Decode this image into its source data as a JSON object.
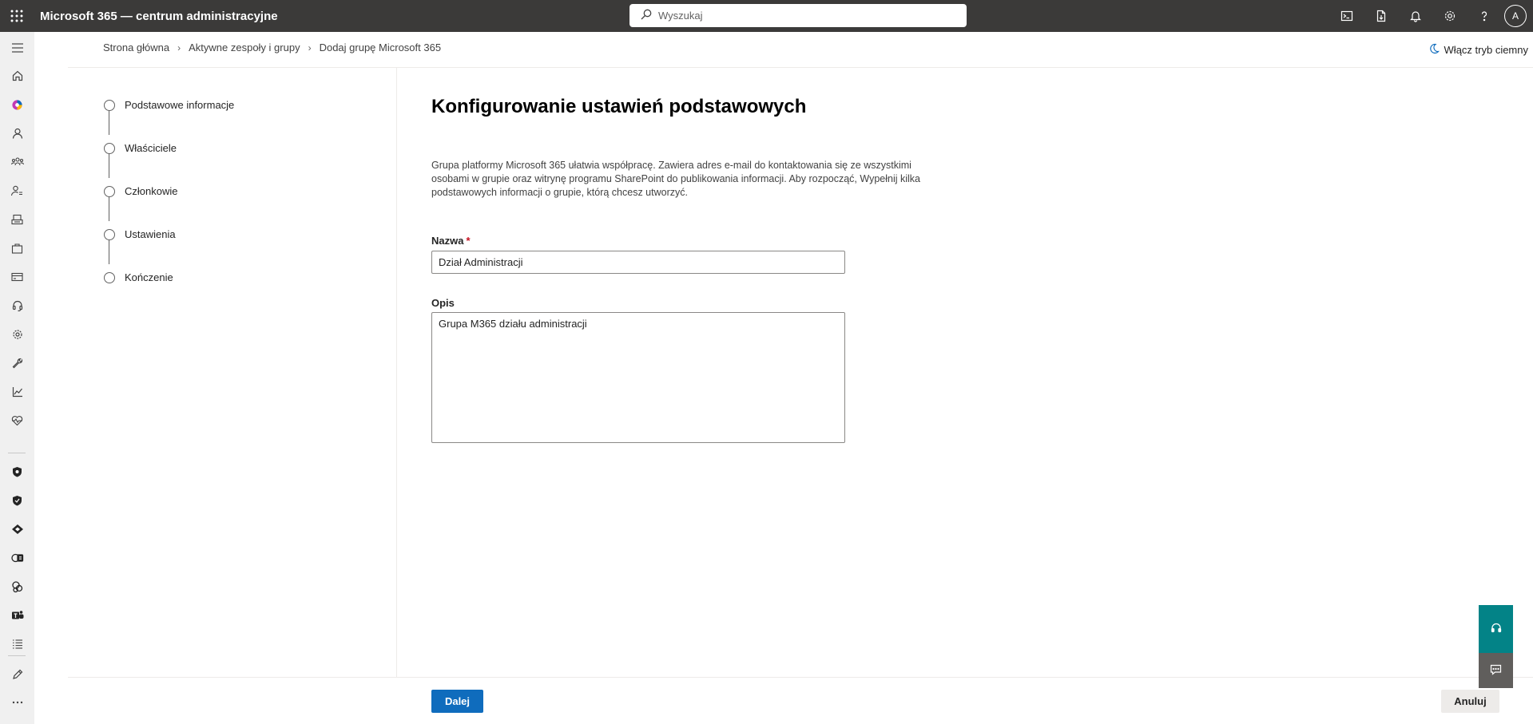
{
  "app": {
    "title": "Microsoft 365 — centrum administracyjne"
  },
  "search": {
    "placeholder": "Wyszukaj"
  },
  "user": {
    "initial": "A"
  },
  "breadcrumb": [
    "Strona główna",
    "Aktywne zespoły i grupy",
    "Dodaj grupę Microsoft 365"
  ],
  "darkmode": {
    "label": "Włącz tryb ciemny"
  },
  "steps": [
    {
      "label": "Podstawowe informacje"
    },
    {
      "label": "Właściciele"
    },
    {
      "label": "Członkowie"
    },
    {
      "label": "Ustawienia"
    },
    {
      "label": "Kończenie"
    }
  ],
  "main": {
    "title": "Konfigurowanie ustawień podstawowych",
    "intro": "Grupa platformy Microsoft 365 ułatwia współpracę. Zawiera adres e-mail do kontaktowania się ze wszystkimi osobami w grupie oraz witrynę programu SharePoint do publikowania informacji. Aby rozpocząć, Wypełnij kilka podstawowych informacji o grupie, którą chcesz utworzyć.",
    "name_label": "Nazwa",
    "name_required": "*",
    "name_value": "Dział Administracji",
    "desc_label": "Opis",
    "desc_value": "Grupa M365 działu administracji"
  },
  "footer": {
    "next_label": "Dalej",
    "cancel_label": "Anuluj"
  },
  "nav_icons": [
    "menu-icon",
    "home-icon",
    "copilot-icon",
    "user-icon",
    "teams-groups-icon",
    "roles-icon",
    "resources-icon",
    "billing-bag-icon",
    "billing-card-icon",
    "support-icon",
    "settings-icon",
    "setup-wrench-icon",
    "reports-icon",
    "health-icon",
    "security-icon",
    "defender-icon",
    "compliance-icon",
    "exchange-icon",
    "sharepoint-icon",
    "teams-icon",
    "all-admin-centers-icon",
    "edit-pen-icon",
    "more-icon"
  ],
  "colors": {
    "topbar": "#3b3a39",
    "primary": "#0f6cbd",
    "help_teal": "#038387",
    "feedback_gray": "#605e5c",
    "required": "#c50f1f"
  }
}
